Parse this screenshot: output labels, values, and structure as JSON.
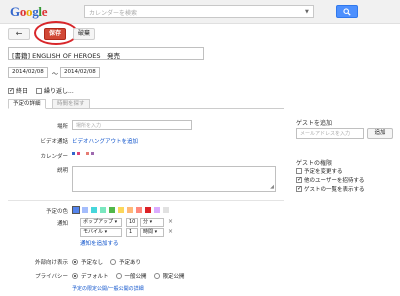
{
  "header": {
    "logo_letters": [
      "G",
      "o",
      "o",
      "g",
      "l",
      "e"
    ],
    "search_placeholder": "カレンダーを検索",
    "search_arrow": "▼"
  },
  "toolbar": {
    "back_label": "←",
    "save_label": "保存",
    "discard_label": "破棄"
  },
  "event": {
    "title": "[書籍] ENGLISH OF HEROES　発売",
    "start_date": "2014/02/08",
    "date_separator": "～",
    "end_date": "2014/02/08",
    "allday_label": "終日",
    "repeat_label": "繰り返し..."
  },
  "tabs": {
    "details": "予定の詳細",
    "find_time": "時間を探す"
  },
  "form": {
    "location_label": "場所",
    "location_placeholder": "場所を入力",
    "video_call_label": "ビデオ通話",
    "video_call_link": "ビデオハングアウトを追加",
    "calendar_label": "カレンダー",
    "calendar_owner": "■ ■ ■ ■",
    "description_label": "説明",
    "event_color_label": "予定の色",
    "reminders_label": "通知",
    "reminders": [
      {
        "type": "ポップアップ ▾",
        "value": "10",
        "unit": "分 ▾",
        "remove": "×"
      },
      {
        "type": "モバイル ▾",
        "value": "1",
        "unit": "時間 ▾",
        "remove": "×"
      }
    ],
    "add_reminder": "通知を追加する",
    "show_me_as_label": "外部向け表示",
    "show_me_as_options": [
      "予定なし",
      "予定あり"
    ],
    "show_me_as_selected": 0,
    "privacy_label": "プライバシー",
    "privacy_options": [
      "デフォルト",
      "一般公開",
      "限定公開"
    ],
    "privacy_selected": 0,
    "privacy_link": "予定の限定公開/一般公開の詳細"
  },
  "colors": {
    "accent_blue": "#4d90fe",
    "save_red": "#d14836",
    "link_blue": "#1155cc",
    "event_swatches": [
      "#5484ed",
      "#a4bdfc",
      "#46d6db",
      "#7ae7bf",
      "#51b749",
      "#fbd75b",
      "#ffb878",
      "#ff887c",
      "#dc2127",
      "#dbadff",
      "#e1e1e1"
    ],
    "event_swatch_selected": 0,
    "calendar_owner_dots": [
      "#3366cc",
      "#dd4477",
      "#e67c73",
      "#9e69af"
    ]
  },
  "guests": {
    "heading": "ゲストを追加",
    "input_placeholder": "メールアドレスを入力",
    "add_button": "追加",
    "permissions_heading": "ゲストの権限",
    "permissions": [
      {
        "label": "予定を変更する",
        "checked": false
      },
      {
        "label": "他のユーザーを招待する",
        "checked": true
      },
      {
        "label": "ゲストの一覧を表示する",
        "checked": true
      }
    ]
  }
}
